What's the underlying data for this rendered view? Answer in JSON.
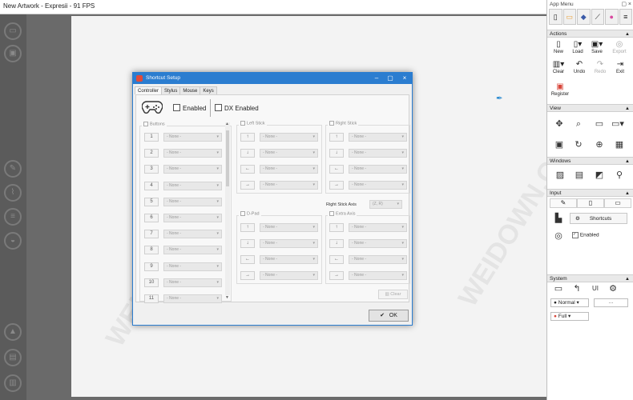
{
  "window": {
    "title": "New Artwork - Expresii - 91 FPS"
  },
  "left_toolbar": {
    "icons": [
      "folder-icon",
      "save-icon",
      "pen-icon",
      "brush-icon",
      "smudge-icon",
      "eraser-icon",
      "navigate-icon",
      "layers-icon",
      "trash-icon"
    ]
  },
  "app_menu": {
    "title": "App Menu",
    "tabs": [
      "page-icon",
      "canvas-icon",
      "layers-icon",
      "brush-icon",
      "color-wheel-icon",
      "menu-icon"
    ],
    "actions": {
      "header": "Actions",
      "buttons": [
        {
          "label": "New"
        },
        {
          "label": "Load"
        },
        {
          "label": "Save"
        },
        {
          "label": "Export",
          "disabled": true
        },
        {
          "label": "Clear"
        },
        {
          "label": "Undo"
        },
        {
          "label": "Redo",
          "disabled": true
        },
        {
          "label": "Exit"
        },
        {
          "label": "Register"
        }
      ]
    },
    "view": {
      "header": "View"
    },
    "windows": {
      "header": "Windows"
    },
    "input": {
      "header": "Input",
      "shortcuts_label": "Shortcuts",
      "enabled_label": "Enabled"
    },
    "system": {
      "header": "System",
      "blend_value": "Normal",
      "more_label": "···",
      "size_value": "Full"
    }
  },
  "dialog": {
    "title": "Shortcut Setup",
    "tabs": [
      "Controller",
      "Stylus",
      "Mouse",
      "Keys"
    ],
    "enabled_label": "Enabled",
    "dx_label": "DX Enabled",
    "buttons_group": {
      "label": "Buttons",
      "numbers": [
        "1",
        "2",
        "3",
        "4",
        "5",
        "6",
        "7",
        "8",
        "9",
        "10",
        "11"
      ],
      "value": "- None -"
    },
    "left_stick": {
      "label": "Left Stick",
      "arrows": [
        "↑",
        "↓",
        "←",
        "→"
      ],
      "value": "- None -"
    },
    "right_stick": {
      "label": "Right Stick",
      "arrows": [
        "↑",
        "↓",
        "←",
        "→"
      ],
      "value": "- None -"
    },
    "dpad": {
      "label": "D-Pad",
      "arrows": [
        "↑",
        "↓",
        "←",
        "→"
      ],
      "value": "- None -"
    },
    "extra_axis": {
      "label": "Extra Axis",
      "arrows": [
        "↑",
        "↓",
        "←",
        "→"
      ],
      "value": "- None -"
    },
    "right_stick_axis": {
      "label": "Right Stick Axis",
      "value": "(Z, R)"
    },
    "clear_label": "Clear",
    "ok_label": "OK"
  }
}
